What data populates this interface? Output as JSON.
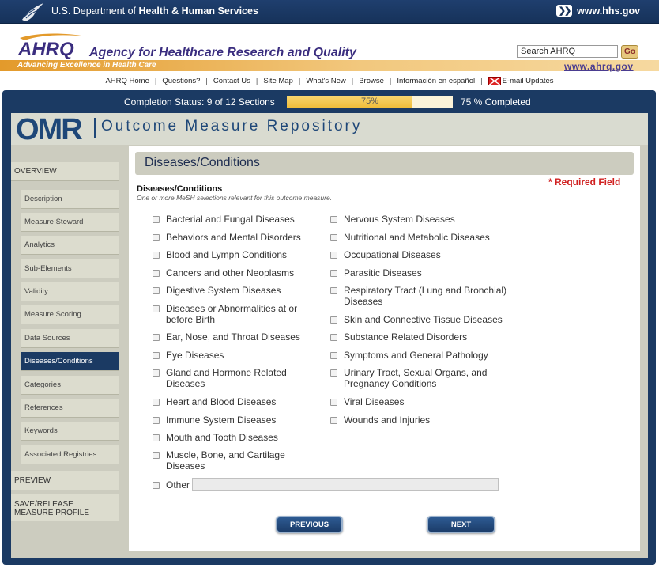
{
  "hhs": {
    "title_prefix": "U.S. Department of ",
    "title_bold": "Health & Human Services",
    "link": "www.hhs.gov"
  },
  "ahrq": {
    "logo_text": "AHRQ",
    "name": "Agency for Healthcare Research and Quality",
    "tagline": "Advancing Excellence in Health Care",
    "url": "www.ahrq.gov",
    "search_value": "Search AHRQ",
    "go_label": "Go"
  },
  "top_nav": [
    "AHRQ Home",
    "Questions?",
    "Contact Us",
    "Site Map",
    "What's New",
    "Browse",
    "Información en español",
    "E-mail Updates"
  ],
  "status": {
    "label": "Completion Status: 9 of 12 Sections",
    "progress_percent": 75,
    "progress_text": "75%",
    "completed_text": "75 % Completed"
  },
  "omr": {
    "logo": "OMR",
    "name": "Outcome Measure Repository"
  },
  "sidebar": {
    "overview": "OVERVIEW",
    "items": [
      "Description",
      "Measure Steward",
      "Analytics",
      "Sub-Elements",
      "Validity",
      "Measure Scoring",
      "Data Sources",
      "Diseases/Conditions",
      "Categories",
      "References",
      "Keywords",
      "Associated Registries"
    ],
    "active_item": "Diseases/Conditions",
    "preview": "PREVIEW",
    "save_line1": "SAVE/RELEASE",
    "save_line2": "MEASURE PROFILE"
  },
  "content": {
    "title": "Diseases/Conditions",
    "required": "* Required Field",
    "section_title": "Diseases/Conditions",
    "section_hint": "One or more MeSH selections relevant for this outcome measure.",
    "col1": [
      {
        "label": "Bacterial and Fungal Diseases",
        "checked": false
      },
      {
        "label": "Behaviors and Mental Disorders",
        "checked": false
      },
      {
        "label": "Blood and Lymph Conditions",
        "checked": false
      },
      {
        "label": "Cancers and other Neoplasms",
        "checked": false
      },
      {
        "label": "Digestive System Diseases",
        "checked": false
      },
      {
        "label": "Diseases or Abnormalities at or before Birth",
        "checked": false
      },
      {
        "label": "Ear, Nose, and Throat Diseases",
        "checked": false
      },
      {
        "label": "Eye Diseases",
        "checked": false
      },
      {
        "label": "Gland and Hormone Related Diseases",
        "checked": false
      },
      {
        "label": "Heart and Blood Diseases",
        "checked": false
      },
      {
        "label": "Immune System Diseases",
        "checked": false
      },
      {
        "label": "Mouth and Tooth Diseases",
        "checked": false
      },
      {
        "label": "Muscle, Bone, and Cartilage Diseases",
        "checked": false
      }
    ],
    "col2": [
      {
        "label": "Nervous System Diseases",
        "checked": false
      },
      {
        "label": "Nutritional and Metabolic Diseases",
        "checked": false
      },
      {
        "label": "Occupational Diseases",
        "checked": false
      },
      {
        "label": "Parasitic Diseases",
        "checked": false
      },
      {
        "label": "Respiratory Tract (Lung and Bronchial) Diseases",
        "checked": false
      },
      {
        "label": "Skin and Connective Tissue Diseases",
        "checked": false
      },
      {
        "label": "Substance Related Disorders",
        "checked": false
      },
      {
        "label": "Symptoms and General Pathology",
        "checked": false
      },
      {
        "label": "Urinary Tract, Sexual Organs, and Pregnancy Conditions",
        "checked": false
      },
      {
        "label": "Viral Diseases",
        "checked": false
      },
      {
        "label": "Wounds and Injuries",
        "checked": false
      }
    ],
    "other_label": "Other",
    "other_value": "",
    "previous_label": "PREVIOUS",
    "next_label": "NEXT"
  }
}
